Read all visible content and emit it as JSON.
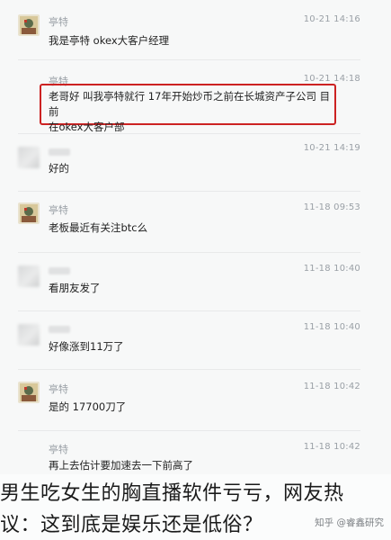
{
  "messages": [
    {
      "sender": "亭特",
      "time": "10-21 14:16",
      "text": "我是亭特 okex大客户经理"
    },
    {
      "sender": "亭特",
      "time": "10-21 14:18",
      "text_line1": "老哥好 叫我亭特就行 17年开始炒币之前在长城资产子公司 目前",
      "text_line2": "在okex大客户部"
    },
    {
      "sender": "",
      "time": "10-21 14:19",
      "text": "好的"
    },
    {
      "sender": "亭特",
      "time": "11-18 09:53",
      "text": "老板最近有关注btc么"
    },
    {
      "sender": "",
      "time": "11-18 10:40",
      "text": "看朋友发了"
    },
    {
      "sender": "",
      "time": "11-18 10:40",
      "text": "好像涨到11万了"
    },
    {
      "sender": "亭特",
      "time": "11-18 10:42",
      "text": "是的 17700刀了"
    },
    {
      "sender": "亭特",
      "time": "11-18 10:42",
      "text": "再上去估计要加速去一下前高了"
    }
  ],
  "caption": {
    "line1": "男生吃女生的胸直播软件亏亏，网友热",
    "line2": "议：这到底是娱乐还是低俗？"
  },
  "watermark": "知乎 @睿鑫研究",
  "colors": {
    "highlight_border": "#cc2222",
    "background": "#f7f8f8"
  }
}
